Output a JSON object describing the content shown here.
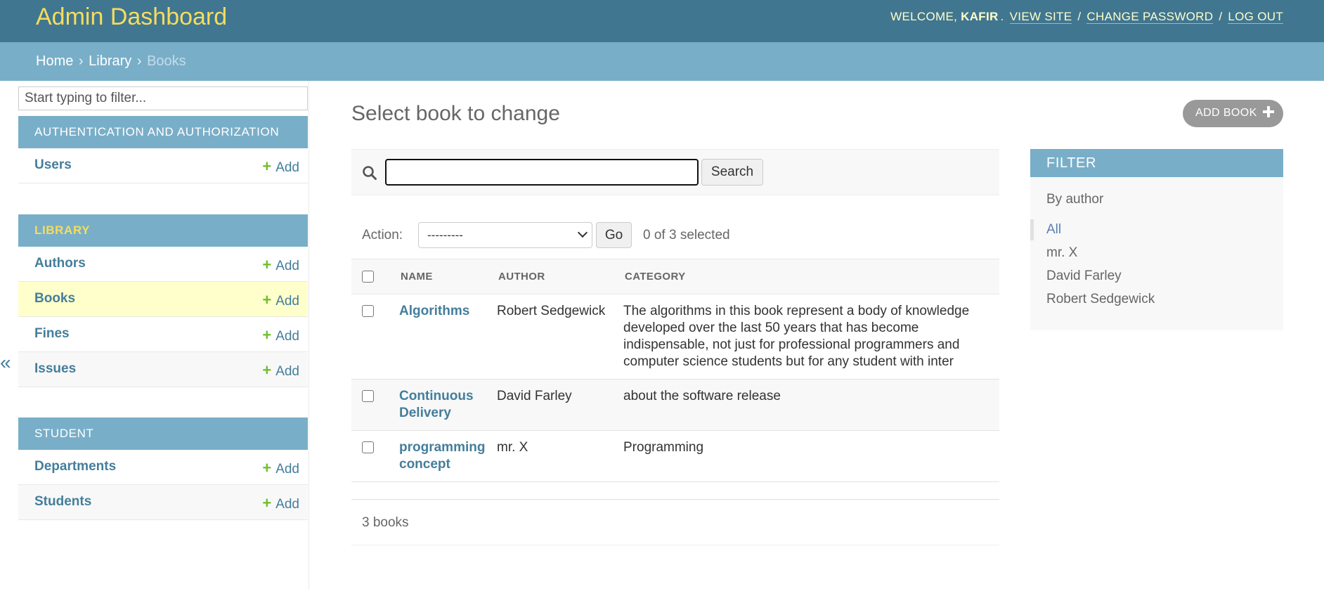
{
  "header": {
    "site_name": "Admin Dashboard",
    "welcome": "WELCOME,",
    "username": "KAFIR",
    "view_site": "VIEW SITE",
    "change_password": "CHANGE PASSWORD",
    "log_out": "LOG OUT"
  },
  "breadcrumbs": {
    "home": "Home",
    "library": "Library",
    "current": "Books"
  },
  "nav": {
    "filter_placeholder": "Start typing to filter...",
    "toggle": "«",
    "modules": [
      {
        "caption": "AUTHENTICATION AND AUTHORIZATION",
        "rows": [
          {
            "model": "Users",
            "add": "Add"
          }
        ]
      },
      {
        "caption": "LIBRARY",
        "rows": [
          {
            "model": "Authors",
            "add": "Add"
          },
          {
            "model": "Books",
            "add": "Add"
          },
          {
            "model": "Fines",
            "add": "Add"
          },
          {
            "model": "Issues",
            "add": "Add"
          }
        ]
      },
      {
        "caption": "STUDENT",
        "rows": [
          {
            "model": "Departments",
            "add": "Add"
          },
          {
            "model": "Students",
            "add": "Add"
          }
        ]
      }
    ]
  },
  "content": {
    "title": "Select book to change",
    "add_button": "ADD BOOK",
    "search_button": "Search",
    "search_value": "",
    "action_label": "Action:",
    "action_selected": "---------",
    "go_button": "Go",
    "selected_count": "0 of 3 selected",
    "columns": [
      "NAME",
      "AUTHOR",
      "CATEGORY"
    ],
    "rows": [
      {
        "name": "Algorithms",
        "author": "Robert Sedgewick",
        "category": "The algorithms in this book represent a body of knowledge developed over the last 50 years that has become indispensable, not just for professional programmers and computer science students but for any student with inter"
      },
      {
        "name": "Continuous Delivery",
        "author": "David Farley",
        "category": "about the software release"
      },
      {
        "name": "programming concept",
        "author": "mr. X",
        "category": "Programming"
      }
    ],
    "paginator": "3 books"
  },
  "filter": {
    "title": "FILTER",
    "by": "By author",
    "options": [
      "All",
      "mr. X",
      "David Farley",
      "Robert Sedgewick"
    ],
    "selected": "All"
  },
  "colors": {
    "header_bg": "#417690",
    "breadcrumb_bg": "#79aec8",
    "site_name": "#f5dd5d",
    "link": "#447e9b",
    "add_plus": "#70bf2b",
    "selected_row": "#ffffcc"
  }
}
